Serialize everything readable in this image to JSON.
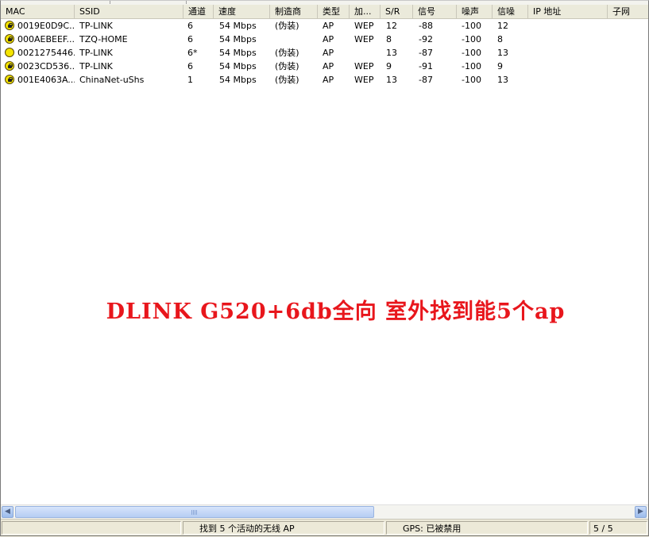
{
  "columns": [
    "MAC",
    "SSID",
    "通道",
    "速度",
    "制造商",
    "类型",
    "加...",
    "S/R",
    "信号",
    "噪声",
    "信噪",
    "IP 地址",
    "子网"
  ],
  "rows": [
    {
      "icon": "locked-ap-icon",
      "mac": "0019E0D9C...",
      "ssid": "TP-LINK",
      "channel": "6",
      "speed": "54 Mbps",
      "vendor": "(伪装)",
      "type": "AP",
      "encryption": "WEP",
      "sr": "12",
      "signal": "-88",
      "noise": "-100",
      "snr": "12",
      "ip": "",
      "subnet": ""
    },
    {
      "icon": "locked-ap-icon",
      "mac": "000AEBEEF...",
      "ssid": "TZQ-HOME",
      "channel": "6",
      "speed": "54 Mbps",
      "vendor": "",
      "type": "AP",
      "encryption": "WEP",
      "sr": "8",
      "signal": "-92",
      "noise": "-100",
      "snr": "8",
      "ip": "",
      "subnet": ""
    },
    {
      "icon": "open-ap-icon",
      "mac": "0021275446...",
      "ssid": "TP-LINK",
      "channel": "6*",
      "speed": "54 Mbps",
      "vendor": "(伪装)",
      "type": "AP",
      "encryption": "",
      "sr": "13",
      "signal": "-87",
      "noise": "-100",
      "snr": "13",
      "ip": "",
      "subnet": ""
    },
    {
      "icon": "locked-ap-icon",
      "mac": "0023CD536...",
      "ssid": "TP-LINK",
      "channel": "6",
      "speed": "54 Mbps",
      "vendor": "(伪装)",
      "type": "AP",
      "encryption": "WEP",
      "sr": "9",
      "signal": "-91",
      "noise": "-100",
      "snr": "9",
      "ip": "",
      "subnet": ""
    },
    {
      "icon": "locked-ap-icon",
      "mac": "001E4063A...",
      "ssid": "ChinaNet-uShs",
      "channel": "1",
      "speed": "54 Mbps",
      "vendor": "(伪装)",
      "type": "AP",
      "encryption": "WEP",
      "sr": "13",
      "signal": "-87",
      "noise": "-100",
      "snr": "13",
      "ip": "",
      "subnet": ""
    }
  ],
  "overlay_text": "DLINK G520+6db全向 室外找到能5个ap",
  "status": {
    "message": "找到 5 个活动的无线 AP",
    "gps": "GPS: 已被禁用",
    "count": "5 / 5"
  },
  "colors": {
    "overlay": "#e8161c",
    "icon_yellow": "#f4e400",
    "header_bg": "#ebeadb",
    "statusbar_bg": "#ece9d8"
  }
}
